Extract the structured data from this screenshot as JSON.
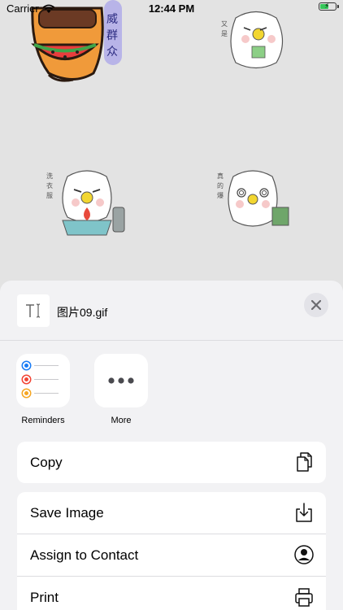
{
  "status_bar": {
    "carrier": "Carrier",
    "time": "12:44 PM",
    "battery_level": 0.6,
    "icons": [
      "wifi-icon",
      "battery-charging-icon"
    ]
  },
  "background": {
    "stickers": [
      "sticker-top-left",
      "sticker-top-right",
      "sticker-middle-left",
      "sticker-middle-right"
    ]
  },
  "share_sheet": {
    "file_name": "图片09.gif",
    "file_icon": "text-cursor-icon",
    "close_icon": "close-icon",
    "apps": [
      {
        "label": "Reminders",
        "icon": "reminders-icon"
      },
      {
        "label": "More",
        "icon": "more-icon"
      }
    ],
    "actions_group1": [
      {
        "label": "Copy",
        "icon": "copy-icon"
      }
    ],
    "actions_group2": [
      {
        "label": "Save Image",
        "icon": "save-image-icon"
      },
      {
        "label": "Assign to Contact",
        "icon": "contact-icon"
      },
      {
        "label": "Print",
        "icon": "print-icon"
      }
    ]
  },
  "colors": {
    "sheet_bg": "#f2f2f4",
    "background": "#e3e3e3",
    "reminder_blue": "#1a7cf5",
    "reminder_red": "#f24535",
    "reminder_orange": "#f5a623",
    "battery_green": "#35c759"
  }
}
